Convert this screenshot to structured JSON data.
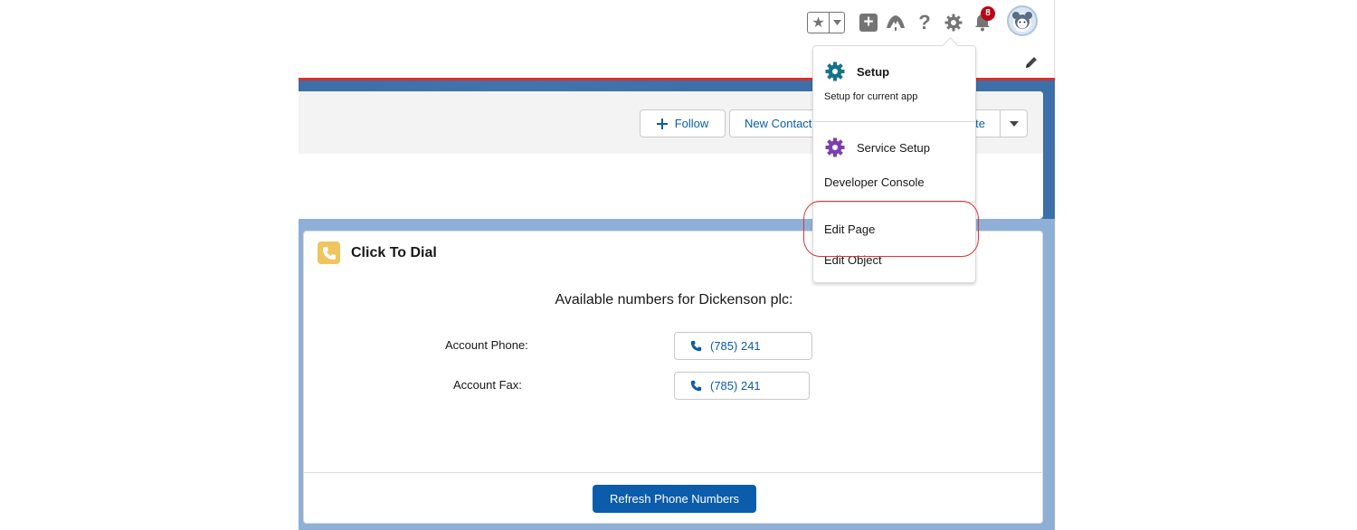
{
  "header": {
    "favorites_icon": "star-icon",
    "global_actions_icon": "plus-icon",
    "trailhead_icon": "trailhead-icon",
    "help_icon": "question-icon",
    "setup_icon": "gear-icon",
    "notifications_icon": "bell-icon",
    "notification_count": "8"
  },
  "record": {
    "actions": {
      "follow": "Follow",
      "new_contact": "New Contact",
      "truncated": "te"
    }
  },
  "setup_menu": {
    "setup_title": "Setup",
    "setup_sub": "Setup for current app",
    "service_setup": "Service Setup",
    "developer_console": "Developer Console",
    "edit_page": "Edit Page",
    "edit_object": "Edit Object"
  },
  "click_to_dial": {
    "title": "Click To Dial",
    "subtitle": "Available numbers for Dickenson plc:",
    "rows": [
      {
        "label": "Account Phone:",
        "number": "(785) 241"
      },
      {
        "label": "Account Fax:",
        "number": "(785) 241"
      }
    ],
    "refresh_label": "Refresh Phone Numbers"
  },
  "colors": {
    "brand_blue": "#0b5cab",
    "badge_red": "#ba0517",
    "dial_icon_yellow": "#f0c55f",
    "annotation_red": "#e2303a"
  }
}
